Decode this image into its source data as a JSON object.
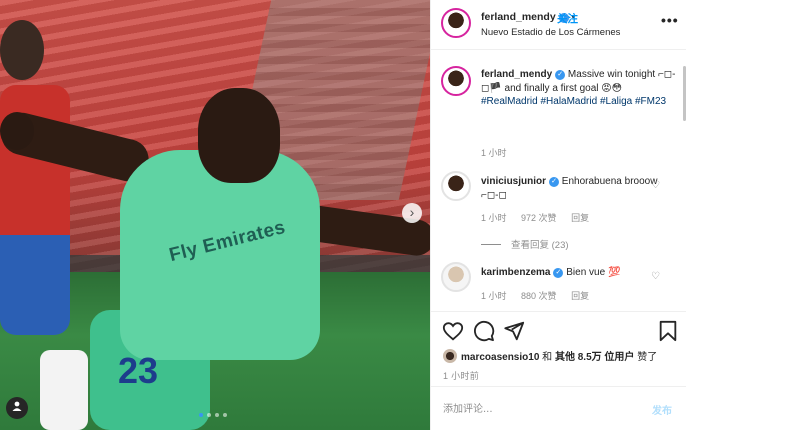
{
  "post": {
    "username": "ferland_mendy",
    "follow_label": "关注",
    "location": "Nuevo Estadio de Los Cármenes",
    "more_icon": "more-horizontal-icon",
    "photo": {
      "jersey_text": "Fly Emirates",
      "shorts_number": "23",
      "carousel_dots": 4,
      "active_dot": 0
    }
  },
  "caption": {
    "username": "ferland_mendy",
    "text": "Massive win tonight ⌐◻-◻🏴 and finally a first goal 😡😳",
    "hashtags": "#RealMadrid #HalaMadrid #Laliga #FM23",
    "time": "1 小时"
  },
  "comments": [
    {
      "username": "viniciusjunior",
      "text": "Enhorabuena brooow ⌐◻-◻",
      "time": "1 小时",
      "likes": "972 次赞",
      "reply": "回复"
    },
    {
      "username": "karimbenzema",
      "text": "Bien vue 💯",
      "time": "1 小时",
      "likes": "880 次赞",
      "reply": "回复"
    }
  ],
  "view_replies": "查看回复 (23)",
  "actions": {
    "like_icon": "heart-icon",
    "comment_icon": "comment-icon",
    "share_icon": "send-icon",
    "save_icon": "bookmark-icon"
  },
  "likes": {
    "liker": "marcoasensio10",
    "text_and": "和",
    "text_other": "其他 8.5万 位用户",
    "text_end": "赞了"
  },
  "timestamp": "1 小时前",
  "add_comment": {
    "placeholder": "添加评论...",
    "post_label": "发布"
  },
  "colors": {
    "link": "#00376b",
    "follow": "#0095f6",
    "muted": "#8e8e8e",
    "verified": "#3897f0"
  }
}
